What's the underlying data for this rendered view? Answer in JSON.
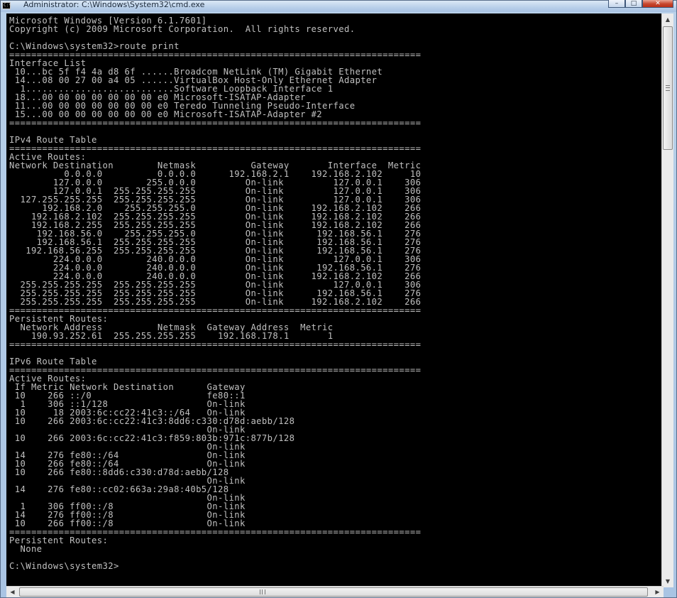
{
  "window": {
    "title": "Administrator: C:\\Windows\\System32\\cmd.exe",
    "icon": "cmd-console-icon",
    "buttons": {
      "minimize_glyph": "–",
      "maximize_glyph": "□",
      "close_glyph": "✕"
    }
  },
  "console": {
    "foreground": "#c0c0c0",
    "background": "#000000",
    "lines": [
      "Microsoft Windows [Version 6.1.7601]",
      "Copyright (c) 2009 Microsoft Corporation.  All rights reserved.",
      "",
      "C:\\Windows\\system32>route print",
      "===========================================================================",
      "Interface List",
      " 10...bc 5f f4 4a d8 6f ......Broadcom NetLink (TM) Gigabit Ethernet",
      " 14...08 00 27 00 a4 05 ......VirtualBox Host-Only Ethernet Adapter",
      "  1...........................Software Loopback Interface 1",
      " 18...00 00 00 00 00 00 00 e0 Microsoft-ISATAP-Adapter",
      " 11...00 00 00 00 00 00 00 e0 Teredo Tunneling Pseudo-Interface",
      " 15...00 00 00 00 00 00 00 e0 Microsoft-ISATAP-Adapter #2",
      "===========================================================================",
      "",
      "IPv4 Route Table",
      "===========================================================================",
      "Active Routes:",
      "Network Destination        Netmask          Gateway       Interface  Metric",
      "          0.0.0.0          0.0.0.0      192.168.2.1    192.168.2.102     10",
      "        127.0.0.0        255.0.0.0         On-link         127.0.0.1    306",
      "        127.0.0.1  255.255.255.255         On-link         127.0.0.1    306",
      "  127.255.255.255  255.255.255.255         On-link         127.0.0.1    306",
      "      192.168.2.0    255.255.255.0         On-link     192.168.2.102    266",
      "    192.168.2.102  255.255.255.255         On-link     192.168.2.102    266",
      "    192.168.2.255  255.255.255.255         On-link     192.168.2.102    266",
      "     192.168.56.0    255.255.255.0         On-link      192.168.56.1    276",
      "     192.168.56.1  255.255.255.255         On-link      192.168.56.1    276",
      "   192.168.56.255  255.255.255.255         On-link      192.168.56.1    276",
      "        224.0.0.0        240.0.0.0         On-link         127.0.0.1    306",
      "        224.0.0.0        240.0.0.0         On-link      192.168.56.1    276",
      "        224.0.0.0        240.0.0.0         On-link     192.168.2.102    266",
      "  255.255.255.255  255.255.255.255         On-link         127.0.0.1    306",
      "  255.255.255.255  255.255.255.255         On-link      192.168.56.1    276",
      "  255.255.255.255  255.255.255.255         On-link     192.168.2.102    266",
      "===========================================================================",
      "Persistent Routes:",
      "  Network Address          Netmask  Gateway Address  Metric",
      "    190.93.252.61  255.255.255.255    192.168.178.1       1",
      "===========================================================================",
      "",
      "IPv6 Route Table",
      "===========================================================================",
      "Active Routes:",
      " If Metric Network Destination      Gateway",
      " 10    266 ::/0                     fe80::1",
      "  1    306 ::1/128                  On-link",
      " 10     18 2003:6c:cc22:41c3::/64   On-link",
      " 10    266 2003:6c:cc22:41c3:8dd6:c330:d78d:aebb/128",
      "                                    On-link",
      " 10    266 2003:6c:cc22:41c3:f859:803b:971c:877b/128",
      "                                    On-link",
      " 14    276 fe80::/64                On-link",
      " 10    266 fe80::/64                On-link",
      " 10    266 fe80::8dd6:c330:d78d:aebb/128",
      "                                    On-link",
      " 14    276 fe80::cc02:663a:29a8:40b5/128",
      "                                    On-link",
      "  1    306 ff00::/8                 On-link",
      " 14    276 ff00::/8                 On-link",
      " 10    266 ff00::/8                 On-link",
      "===========================================================================",
      "Persistent Routes:",
      "  None",
      "",
      "C:\\Windows\\system32>"
    ]
  },
  "scrollbars": {
    "up_glyph": "▲",
    "down_glyph": "▼",
    "left_glyph": "◀",
    "right_glyph": "▶"
  }
}
